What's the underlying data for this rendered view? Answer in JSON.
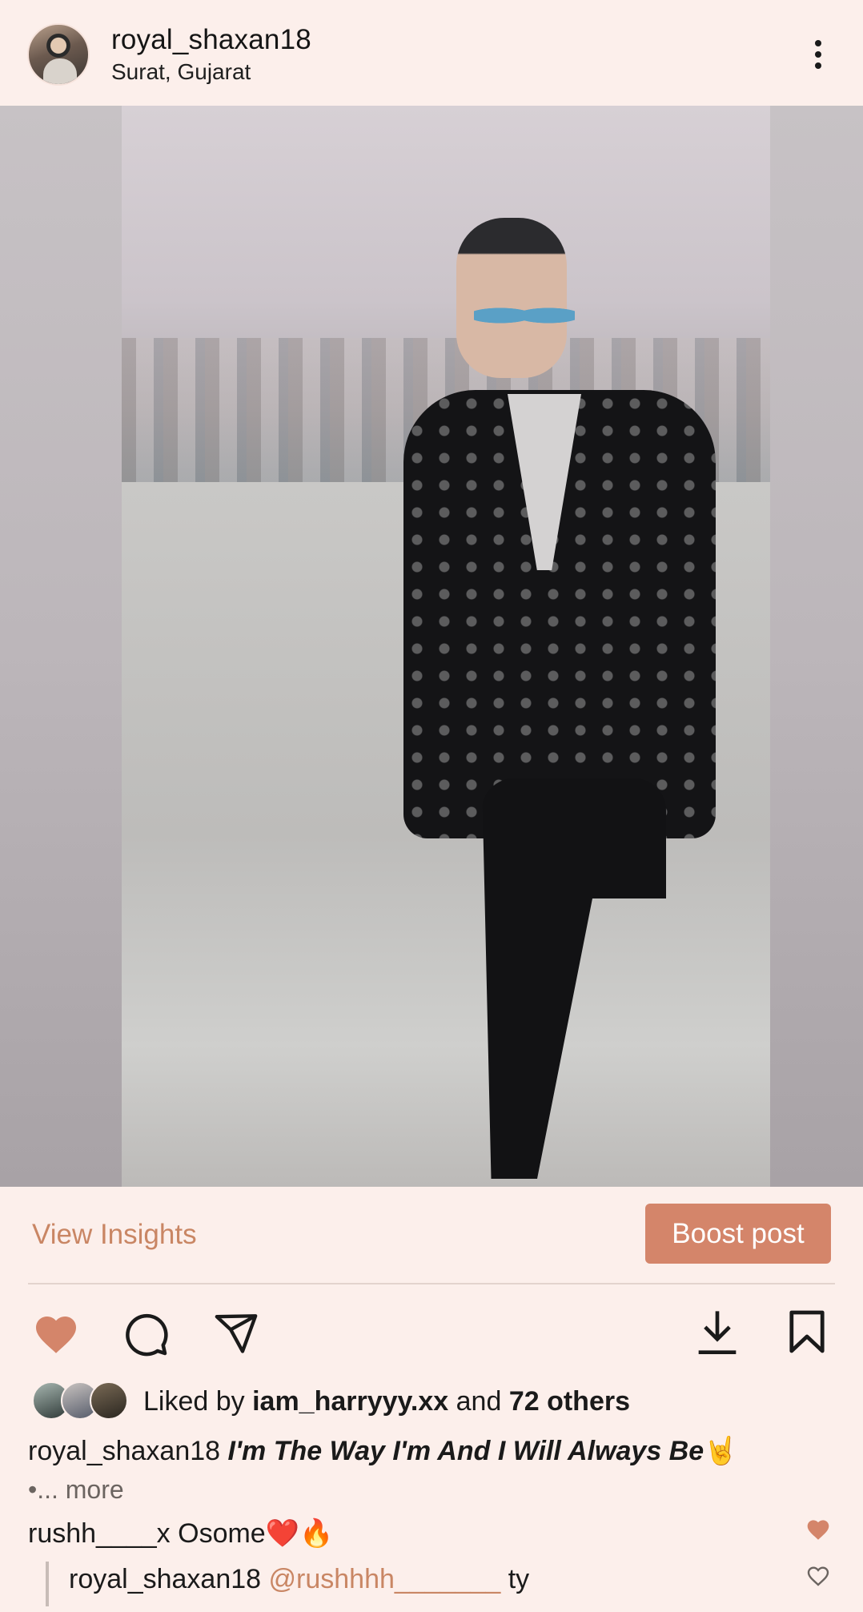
{
  "header": {
    "username": "royal_shaxan18",
    "location": "Surat, Gujarat",
    "more_icon": "more-vertical-icon"
  },
  "post": {
    "image_alt": "Man in black patterned blazer posing on a rooftop"
  },
  "insights": {
    "view_insights_label": "View Insights",
    "boost_label": "Boost post",
    "accent_color": "#d4856a"
  },
  "actions": {
    "like_icon": "heart-filled-icon",
    "comment_icon": "comment-icon",
    "share_icon": "send-icon",
    "download_icon": "download-icon",
    "save_icon": "bookmark-icon"
  },
  "likes": {
    "prefix": "Liked by ",
    "user": "iam_harryyy.xx",
    "middle": " and ",
    "others": "72 others"
  },
  "caption": {
    "username": "royal_shaxan18",
    "text": "I'm The Way I'm And I Will Always Be",
    "emoji": "🤘",
    "more": "•... more"
  },
  "comments": [
    {
      "username": "rushh____x",
      "text": " Osome❤️🔥"
    },
    {
      "username": "royal_shaxan18",
      "mention": "@rushhhh_______",
      "text": " ty"
    }
  ]
}
